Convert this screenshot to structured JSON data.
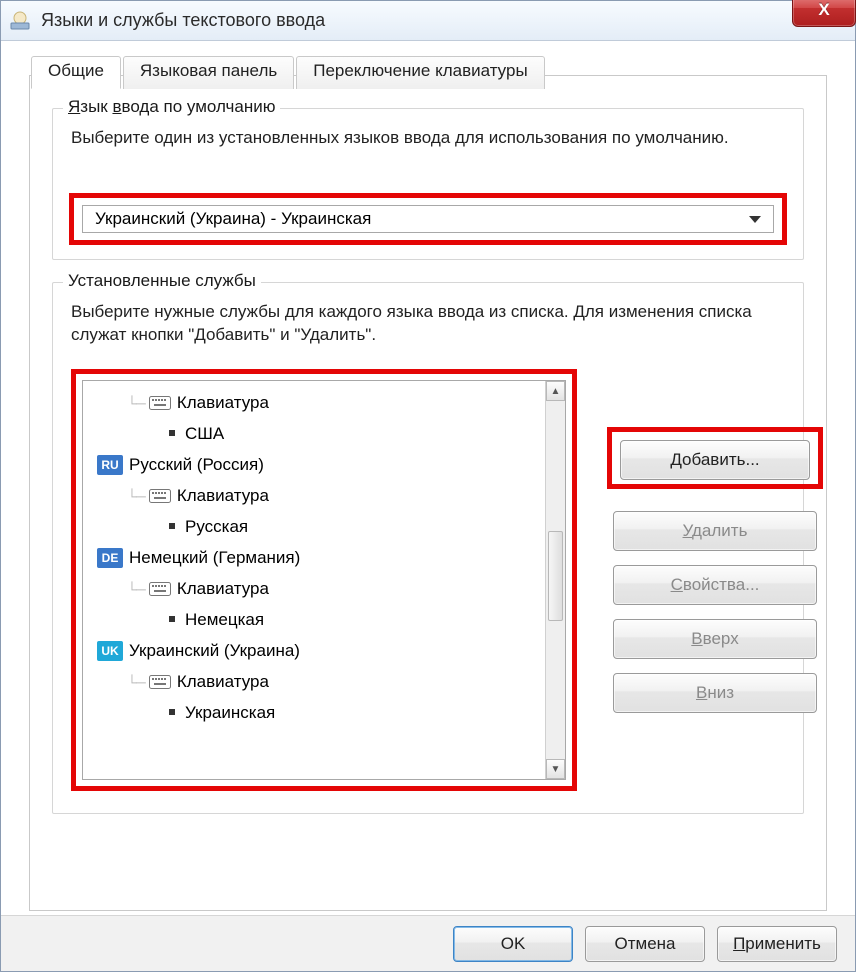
{
  "window": {
    "title": "Языки и службы текстового ввода"
  },
  "close_label": "X",
  "tabs": [
    {
      "label": "Общие"
    },
    {
      "label": "Языковая панель"
    },
    {
      "label": "Переключение клавиатуры"
    }
  ],
  "group_default": {
    "legend": "Язык ввода по умолчанию",
    "desc": "Выберите один из установленных языков ввода для использования по умолчанию.",
    "selected": "Украинский (Украина) - Украинская"
  },
  "group_services": {
    "legend": "Установленные службы",
    "desc": "Выберите нужные службы для каждого языка ввода из списка. Для изменения списка служат кнопки \"Добавить\" и \"Удалить\"."
  },
  "tree": {
    "kbd_label": "Клавиатура",
    "items": [
      {
        "layout": "США"
      },
      {
        "badge": "RU",
        "name": "Русский (Россия)",
        "layout": "Русская"
      },
      {
        "badge": "DE",
        "name": "Немецкий (Германия)",
        "layout": "Немецкая"
      },
      {
        "badge": "UK",
        "name": "Украинский (Украина)",
        "layout": "Украинская"
      }
    ]
  },
  "buttons": {
    "add": "Добавить...",
    "remove": "Удалить",
    "props": "Свойства...",
    "up": "Вверх",
    "down": "Вниз",
    "ok": "OK",
    "cancel": "Отмена",
    "apply": "Применить"
  },
  "accel": {
    "add_u": "Д",
    "remove_u": "У",
    "props_u": "С",
    "up_u": "В",
    "down_u": "В",
    "apply_u": "П",
    "legend1_u": "Я",
    "legend1_u2": "в"
  }
}
